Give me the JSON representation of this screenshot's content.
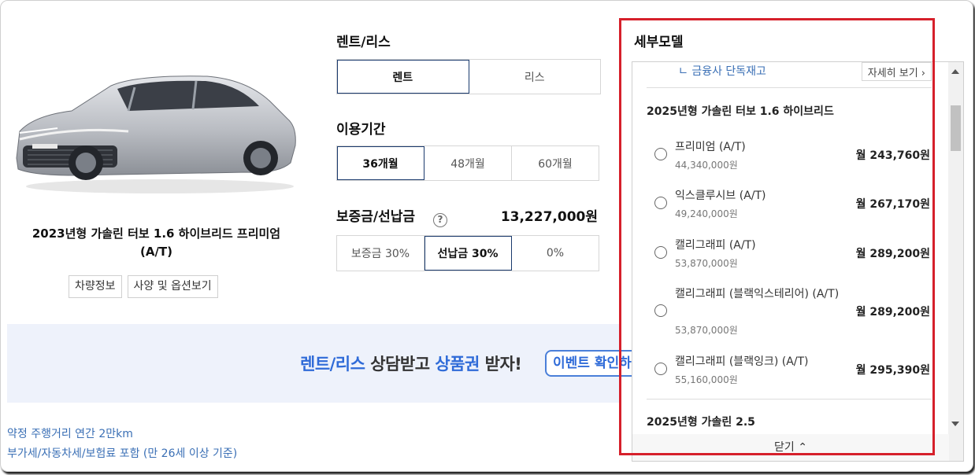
{
  "car": {
    "title": "2023년형 가솔린 터보 1.6 하이브리드 프리미엄 (A/T)",
    "buttons": [
      "차량정보",
      "사양 및 옵션보기"
    ]
  },
  "rent_lease": {
    "label": "렌트/리스",
    "options": [
      "렌트",
      "리스"
    ],
    "selected": "렌트"
  },
  "period": {
    "label": "이용기간",
    "options": [
      "36개월",
      "48개월",
      "60개월"
    ],
    "selected": "36개월"
  },
  "deposit": {
    "label": "보증금/선납금",
    "help": "?",
    "amount": "13,227,000원",
    "options": [
      "보증금 30%",
      "선납금 30%",
      "0%"
    ],
    "selected": "선납금 30%"
  },
  "banner": {
    "part1": "렌트/리스",
    "part2": " 상담받고 ",
    "part3": "상품권",
    "part4": " 받자!",
    "event_button": "이벤트 확인하기"
  },
  "notes": [
    "약정 주행거리 연간 2만km",
    "부가세/자동차세/보험료 포함 (만 26세 이상 기준)"
  ],
  "submodel": {
    "title": "세부모델",
    "finance_label": "ㄴ 금융사 단독재고",
    "detail_button": "자세히 보기 ›",
    "groups": [
      {
        "title": "2025년형 가솔린 터보 1.6 하이브리드",
        "items": [
          {
            "name": "프리미엄 (A/T)",
            "price": "44,340,000원",
            "monthly": "월 243,760원"
          },
          {
            "name": "익스클루시브 (A/T)",
            "price": "49,240,000원",
            "monthly": "월 267,170원"
          },
          {
            "name": "캘리그래피 (A/T)",
            "price": "53,870,000원",
            "monthly": "월 289,200원"
          },
          {
            "name": "캘리그래피 (블랙익스테리어) (A/T)",
            "price": "53,870,000원",
            "monthly": "월 289,200원"
          },
          {
            "name": "캘리그래피 (블랙잉크) (A/T)",
            "price": "55,160,000원",
            "monthly": "월 295,390원"
          }
        ]
      },
      {
        "title": "2025년형 가솔린 2.5",
        "items": []
      }
    ],
    "close_label": "닫기 ⌃"
  },
  "colors": {
    "accent_blue": "#2f6bd8",
    "link_blue": "#3a6fb5",
    "active_border": "#1a3a6d",
    "highlight_red": "#d6202b",
    "car_body": "#c9ccd1"
  },
  "icons": [
    "car-image",
    "help-icon",
    "chevron-right-icon",
    "chevron-up-icon"
  ]
}
